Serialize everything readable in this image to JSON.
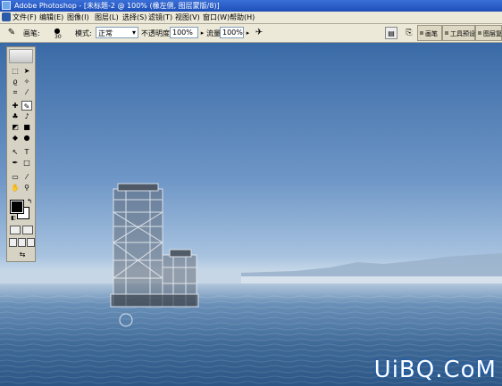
{
  "titlebar": {
    "title": "Adobe Photoshop - [未标题-2 @ 100% (橡左侧, 图层蒙版/8)]"
  },
  "menu": {
    "items": [
      "文件(F)",
      "编辑(E)",
      "图像(I)",
      "图层(L)",
      "选择(S)",
      "滤镜(T)",
      "视图(V)",
      "窗口(W)",
      "帮助(H)"
    ]
  },
  "options": {
    "brush_label": "画笔:",
    "brush_size": "30",
    "mode_label": "模式:",
    "mode_value": "正常",
    "opacity_label": "不透明度:",
    "opacity_value": "100%",
    "flow_label": "流量:",
    "flow_value": "100%",
    "tabs": [
      "画笔",
      "工具预设",
      "图层复合"
    ]
  },
  "toolbox": {
    "tools": [
      "选框",
      "移动",
      "套索",
      "魔棒",
      "裁切",
      "切片",
      "修复画笔",
      "画笔",
      "图章",
      "历史记录画笔",
      "橡皮擦",
      "渐变",
      "模糊",
      "减淡",
      "路径选择",
      "文字",
      "钢笔",
      "形状",
      "注释",
      "吸管",
      "抓手",
      "缩放"
    ]
  },
  "watermark": "UiBQ.CoM",
  "colors": {
    "titlebar": "#2453c1",
    "chrome": "#ece9d8",
    "sky": "#6f97c7",
    "sea": "#3a6695"
  }
}
